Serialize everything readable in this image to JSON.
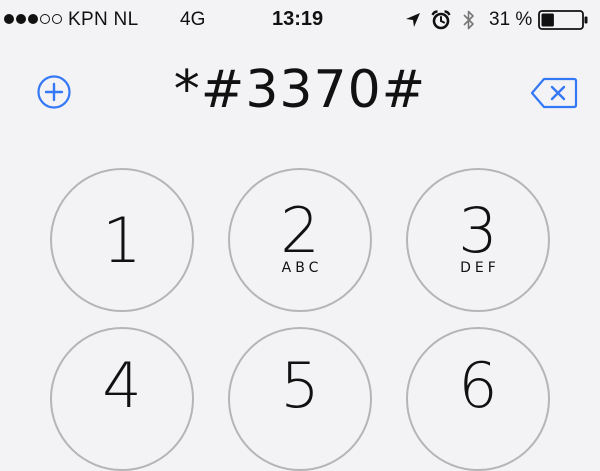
{
  "status_bar": {
    "signal_dots": [
      true,
      true,
      true,
      false,
      false
    ],
    "carrier": "KPN NL",
    "network": "4G",
    "time": "13:19",
    "battery_percent_text": "31 %",
    "battery_level": 0.31
  },
  "dialer": {
    "number": "*#3370#"
  },
  "keypad": {
    "keys": [
      {
        "digit": "1",
        "letters": ""
      },
      {
        "digit": "2",
        "letters": "ABC"
      },
      {
        "digit": "3",
        "letters": "DEF"
      },
      {
        "digit": "4",
        "letters": ""
      },
      {
        "digit": "5",
        "letters": ""
      },
      {
        "digit": "6",
        "letters": ""
      }
    ]
  },
  "colors": {
    "accent": "#3478f6",
    "key_border": "#b5b5b8",
    "background": "#f3f3f5"
  },
  "icons": {
    "add_contact": "plus-circle-icon",
    "delete": "backspace-icon",
    "location": "location-arrow-icon",
    "alarm": "alarm-clock-icon",
    "bluetooth": "bluetooth-icon",
    "battery": "battery-icon"
  }
}
